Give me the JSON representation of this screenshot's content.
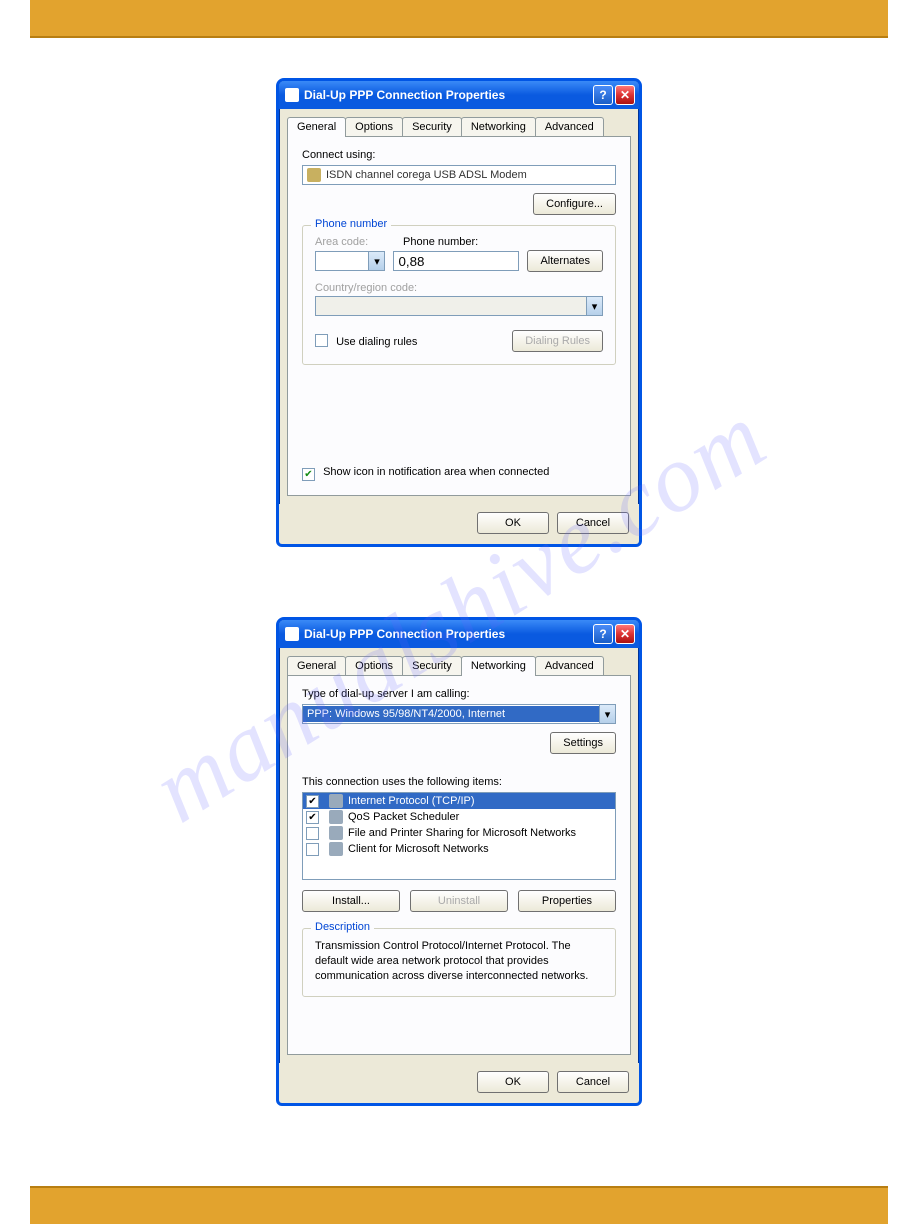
{
  "watermark_text": "manualshive.com",
  "dialog1": {
    "title": "Dial-Up PPP Connection Properties",
    "tabs": [
      "General",
      "Options",
      "Security",
      "Networking",
      "Advanced"
    ],
    "active_tab": "General",
    "connect_using_label": "Connect using:",
    "connect_using_value": "ISDN  channel  corega USB ADSL Modem",
    "configure_btn": "Configure...",
    "phone_group_legend": "Phone number",
    "area_code_label": "Area code:",
    "area_code_value": "",
    "phone_label": "Phone number:",
    "phone_value": "0,88",
    "alternates_btn": "Alternates",
    "country_label": "Country/region code:",
    "country_value": "",
    "use_dialing_rules_label": "Use dialing rules",
    "use_dialing_rules_checked": false,
    "dialing_rules_btn": "Dialing Rules",
    "show_icon_label": "Show icon in notification area when connected",
    "show_icon_checked": true,
    "ok_btn": "OK",
    "cancel_btn": "Cancel"
  },
  "dialog2": {
    "title": "Dial-Up PPP Connection Properties",
    "tabs": [
      "General",
      "Options",
      "Security",
      "Networking",
      "Advanced"
    ],
    "active_tab": "Networking",
    "type_label": "Type of dial-up server I am calling:",
    "type_value": "PPP: Windows 95/98/NT4/2000, Internet",
    "settings_btn": "Settings",
    "items_label": "This connection uses the following items:",
    "items": [
      {
        "checked": true,
        "label": "Internet Protocol (TCP/IP)",
        "selected": true
      },
      {
        "checked": true,
        "label": "QoS Packet Scheduler",
        "selected": false
      },
      {
        "checked": false,
        "label": "File and Printer Sharing for Microsoft Networks",
        "selected": false
      },
      {
        "checked": false,
        "label": "Client for Microsoft Networks",
        "selected": false
      }
    ],
    "install_btn": "Install...",
    "uninstall_btn": "Uninstall",
    "properties_btn": "Properties",
    "desc_legend": "Description",
    "desc_text": "Transmission Control Protocol/Internet Protocol. The default wide area network protocol that provides communication across diverse interconnected networks.",
    "ok_btn": "OK",
    "cancel_btn": "Cancel"
  }
}
